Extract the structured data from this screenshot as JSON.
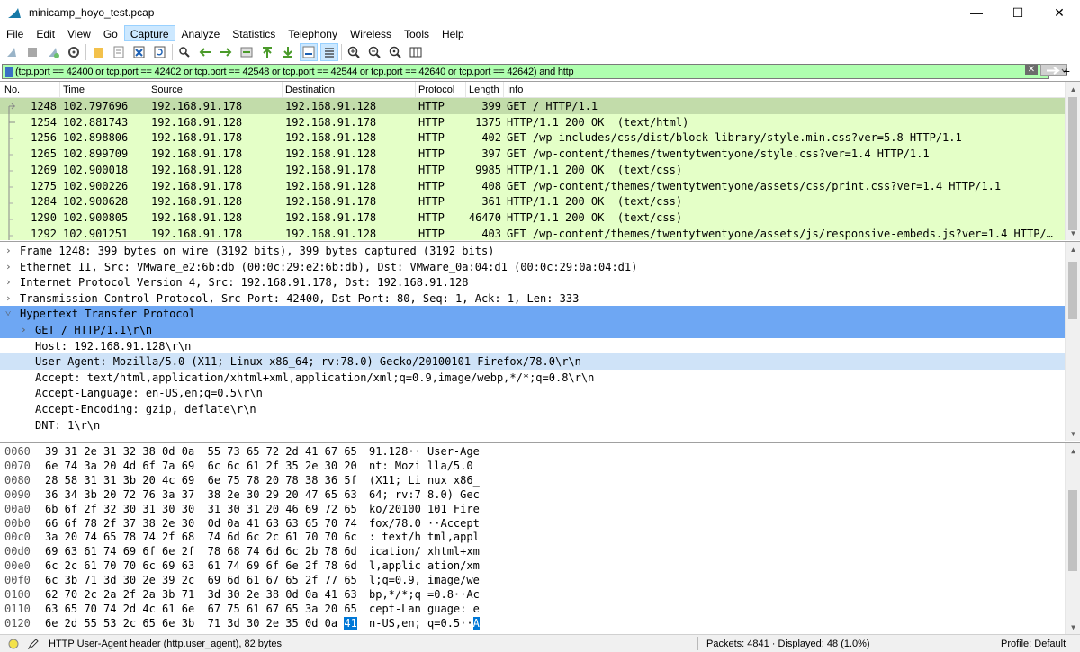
{
  "window": {
    "title": "minicamp_hoyo_test.pcap",
    "minimize": "—",
    "maximize": "☐",
    "close": "✕"
  },
  "menu": [
    "File",
    "Edit",
    "View",
    "Go",
    "Capture",
    "Analyze",
    "Statistics",
    "Telephony",
    "Wireless",
    "Tools",
    "Help"
  ],
  "filter": {
    "text": "(tcp.port == 42400 or tcp.port == 42402 or tcp.port == 42548  or tcp.port == 42544 or tcp.port == 42640  or tcp.port == 42642) and http",
    "bg_color": "#afffaf",
    "add_button": "+"
  },
  "packet_list": {
    "columns": [
      "No.",
      "Time",
      "Source",
      "Destination",
      "Protocol",
      "Length",
      "Info"
    ],
    "rows": [
      {
        "no": "1248",
        "time": "102.797696",
        "src": "192.168.91.178",
        "dst": "192.168.91.128",
        "proto": "HTTP",
        "len": "399",
        "info": "GET / HTTP/1.1"
      },
      {
        "no": "1254",
        "time": "102.881743",
        "src": "192.168.91.128",
        "dst": "192.168.91.178",
        "proto": "HTTP",
        "len": "1375",
        "info": "HTTP/1.1 200 OK  (text/html)"
      },
      {
        "no": "1256",
        "time": "102.898806",
        "src": "192.168.91.178",
        "dst": "192.168.91.128",
        "proto": "HTTP",
        "len": "402",
        "info": "GET /wp-includes/css/dist/block-library/style.min.css?ver=5.8 HTTP/1.1"
      },
      {
        "no": "1265",
        "time": "102.899709",
        "src": "192.168.91.178",
        "dst": "192.168.91.128",
        "proto": "HTTP",
        "len": "397",
        "info": "GET /wp-content/themes/twentytwentyone/style.css?ver=1.4 HTTP/1.1"
      },
      {
        "no": "1269",
        "time": "102.900018",
        "src": "192.168.91.128",
        "dst": "192.168.91.178",
        "proto": "HTTP",
        "len": "9985",
        "info": "HTTP/1.1 200 OK  (text/css)"
      },
      {
        "no": "1275",
        "time": "102.900226",
        "src": "192.168.91.178",
        "dst": "192.168.91.128",
        "proto": "HTTP",
        "len": "408",
        "info": "GET /wp-content/themes/twentytwentyone/assets/css/print.css?ver=1.4 HTTP/1.1"
      },
      {
        "no": "1284",
        "time": "102.900628",
        "src": "192.168.91.128",
        "dst": "192.168.91.178",
        "proto": "HTTP",
        "len": "361",
        "info": "HTTP/1.1 200 OK  (text/css)"
      },
      {
        "no": "1290",
        "time": "102.900805",
        "src": "192.168.91.128",
        "dst": "192.168.91.178",
        "proto": "HTTP",
        "len": "46470",
        "info": "HTTP/1.1 200 OK  (text/css)"
      },
      {
        "no": "1292",
        "time": "102.901251",
        "src": "192.168.91.178",
        "dst": "192.168.91.128",
        "proto": "HTTP",
        "len": "403",
        "info": "GET /wp-content/themes/twentytwentyone/assets/js/responsive-embeds.js?ver=1.4 HTTP/…"
      }
    ],
    "row_color": "#e4ffc7",
    "selected_color": "#c2dcaa"
  },
  "details": [
    {
      "indent": 0,
      "chev": ">",
      "text": "Frame 1248: 399 bytes on wire (3192 bits), 399 bytes captured (3192 bits)"
    },
    {
      "indent": 0,
      "chev": ">",
      "text": "Ethernet II, Src: VMware_e2:6b:db (00:0c:29:e2:6b:db), Dst: VMware_0a:04:d1 (00:0c:29:0a:04:d1)"
    },
    {
      "indent": 0,
      "chev": ">",
      "text": "Internet Protocol Version 4, Src: 192.168.91.178, Dst: 192.168.91.128"
    },
    {
      "indent": 0,
      "chev": ">",
      "text": "Transmission Control Protocol, Src Port: 42400, Dst Port: 80, Seq: 1, Ack: 1, Len: 333"
    },
    {
      "indent": 0,
      "chev": "v",
      "text": "Hypertext Transfer Protocol",
      "state": "sel"
    },
    {
      "indent": 1,
      "chev": ">",
      "text": "GET / HTTP/1.1\\r\\n",
      "state": "sel"
    },
    {
      "indent": 1,
      "chev": "",
      "text": "Host: 192.168.91.128\\r\\n"
    },
    {
      "indent": 1,
      "chev": "",
      "text": "User-Agent: Mozilla/5.0 (X11; Linux x86_64; rv:78.0) Gecko/20100101 Firefox/78.0\\r\\n",
      "state": "subsel"
    },
    {
      "indent": 1,
      "chev": "",
      "text": "Accept: text/html,application/xhtml+xml,application/xml;q=0.9,image/webp,*/*;q=0.8\\r\\n"
    },
    {
      "indent": 1,
      "chev": "",
      "text": "Accept-Language: en-US,en;q=0.5\\r\\n"
    },
    {
      "indent": 1,
      "chev": "",
      "text": "Accept-Encoding: gzip, deflate\\r\\n"
    },
    {
      "indent": 1,
      "chev": "",
      "text": "DNT: 1\\r\\n"
    }
  ],
  "hex": [
    {
      "off": "0060",
      "hex": "39 31 2e 31 32 38 0d 0a  55 73 65 72 2d 41 67 65",
      "asc": "91.128·· User-Age"
    },
    {
      "off": "0070",
      "hex": "6e 74 3a 20 4d 6f 7a 69  6c 6c 61 2f 35 2e 30 20",
      "asc": "nt: Mozi lla/5.0 "
    },
    {
      "off": "0080",
      "hex": "28 58 31 31 3b 20 4c 69  6e 75 78 20 78 38 36 5f",
      "asc": "(X11; Li nux x86_"
    },
    {
      "off": "0090",
      "hex": "36 34 3b 20 72 76 3a 37  38 2e 30 29 20 47 65 63",
      "asc": "64; rv:7 8.0) Gec"
    },
    {
      "off": "00a0",
      "hex": "6b 6f 2f 32 30 31 30 30  31 30 31 20 46 69 72 65",
      "asc": "ko/20100 101 Fire"
    },
    {
      "off": "00b0",
      "hex": "66 6f 78 2f 37 38 2e 30  0d 0a 41 63 63 65 70 74",
      "asc": "fox/78.0 ··Accept"
    },
    {
      "off": "00c0",
      "hex": "3a 20 74 65 78 74 2f 68  74 6d 6c 2c 61 70 70 6c",
      "asc": ": text/h tml,appl"
    },
    {
      "off": "00d0",
      "hex": "69 63 61 74 69 6f 6e 2f  78 68 74 6d 6c 2b 78 6d",
      "asc": "ication/ xhtml+xm"
    },
    {
      "off": "00e0",
      "hex": "6c 2c 61 70 70 6c 69 63  61 74 69 6f 6e 2f 78 6d",
      "asc": "l,applic ation/xm"
    },
    {
      "off": "00f0",
      "hex": "6c 3b 71 3d 30 2e 39 2c  69 6d 61 67 65 2f 77 65",
      "asc": "l;q=0.9, image/we"
    },
    {
      "off": "0100",
      "hex": "62 70 2c 2a 2f 2a 3b 71  3d 30 2e 38 0d 0a 41 63",
      "asc": "bp,*/*;q =0.8··Ac"
    },
    {
      "off": "0110",
      "hex": "63 65 70 74 2d 4c 61 6e  67 75 61 67 65 3a 20 65",
      "asc": "cept-Lan guage: e"
    },
    {
      "off": "0120",
      "hex": "6e 2d 55 53 2c 65 6e 3b  71 3d 30 2e 35 0d 0a ",
      "hexhl": "41",
      "asc": "n-US,en; q=0.5··",
      "aschl": "A"
    }
  ],
  "status": {
    "field": "HTTP User-Agent header (http.user_agent), 82 bytes",
    "packets": "Packets: 4841 · Displayed: 48 (1.0%)",
    "profile": "Profile: Default"
  }
}
